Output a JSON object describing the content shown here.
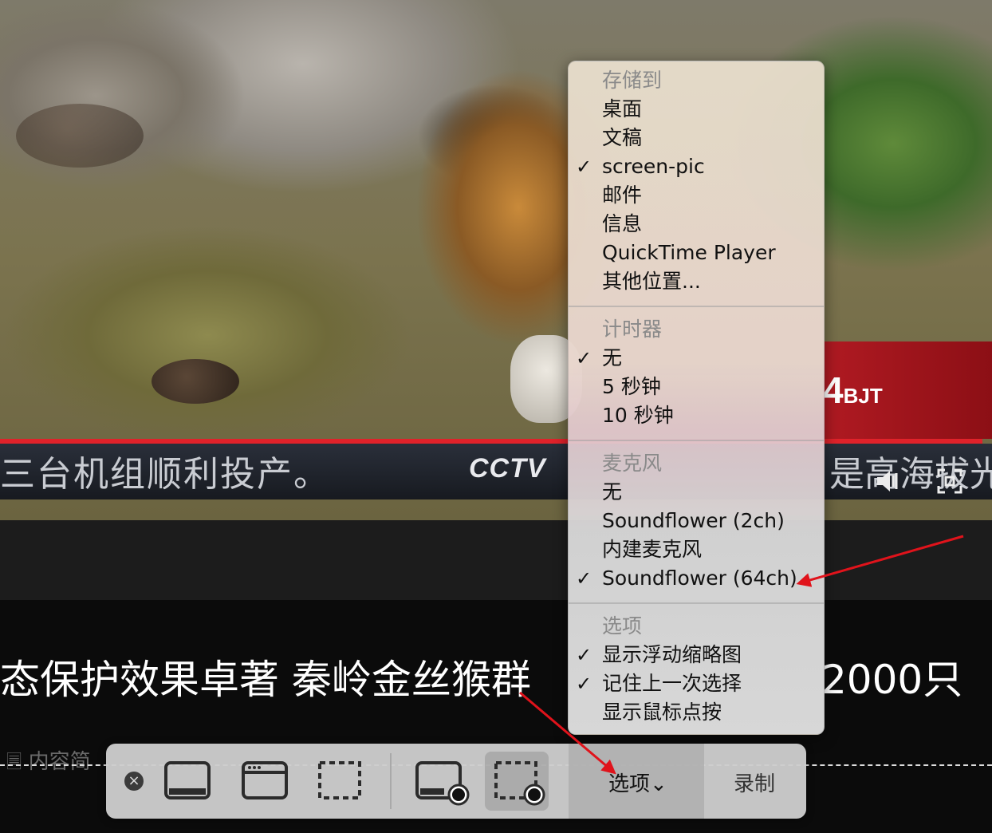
{
  "video": {
    "ticker_text": "三台机组顺利投产。",
    "ticker_right": "是高海拔光",
    "channel_logo": "CCTV",
    "clock_suffix": "4",
    "clock_unit": "BJT"
  },
  "page": {
    "headline": "态保护效果卓著 秦岭金丝猴群",
    "headline_right": "2000只",
    "content_label": "内容简"
  },
  "menu": {
    "save_to": {
      "header": "存储到",
      "items": [
        {
          "label": "桌面",
          "checked": false
        },
        {
          "label": "文稿",
          "checked": false
        },
        {
          "label": "screen-pic",
          "checked": true
        },
        {
          "label": "邮件",
          "checked": false
        },
        {
          "label": "信息",
          "checked": false
        },
        {
          "label": "QuickTime Player",
          "checked": false
        },
        {
          "label": "其他位置...",
          "checked": false
        }
      ]
    },
    "timer": {
      "header": "计时器",
      "items": [
        {
          "label": "无",
          "checked": true
        },
        {
          "label": "5 秒钟",
          "checked": false
        },
        {
          "label": "10 秒钟",
          "checked": false
        }
      ]
    },
    "microphone": {
      "header": "麦克风",
      "items": [
        {
          "label": "无",
          "checked": false
        },
        {
          "label": "Soundflower (2ch)",
          "checked": false
        },
        {
          "label": "内建麦克风",
          "checked": false
        },
        {
          "label": "Soundflower (64ch)",
          "checked": true
        }
      ]
    },
    "options": {
      "header": "选项",
      "items": [
        {
          "label": "显示浮动缩略图",
          "checked": true
        },
        {
          "label": "记住上一次选择",
          "checked": true
        },
        {
          "label": "显示鼠标点按",
          "checked": false
        }
      ]
    },
    "check_glyph": "✓"
  },
  "toolbar": {
    "close_glyph": "×",
    "options_label": "选项⌄",
    "record_label": "录制"
  },
  "colors": {
    "annotation_arrow": "#e0131b",
    "toolbar_bg": "#cdcdcd",
    "menu_header": "#8a8a8a"
  }
}
